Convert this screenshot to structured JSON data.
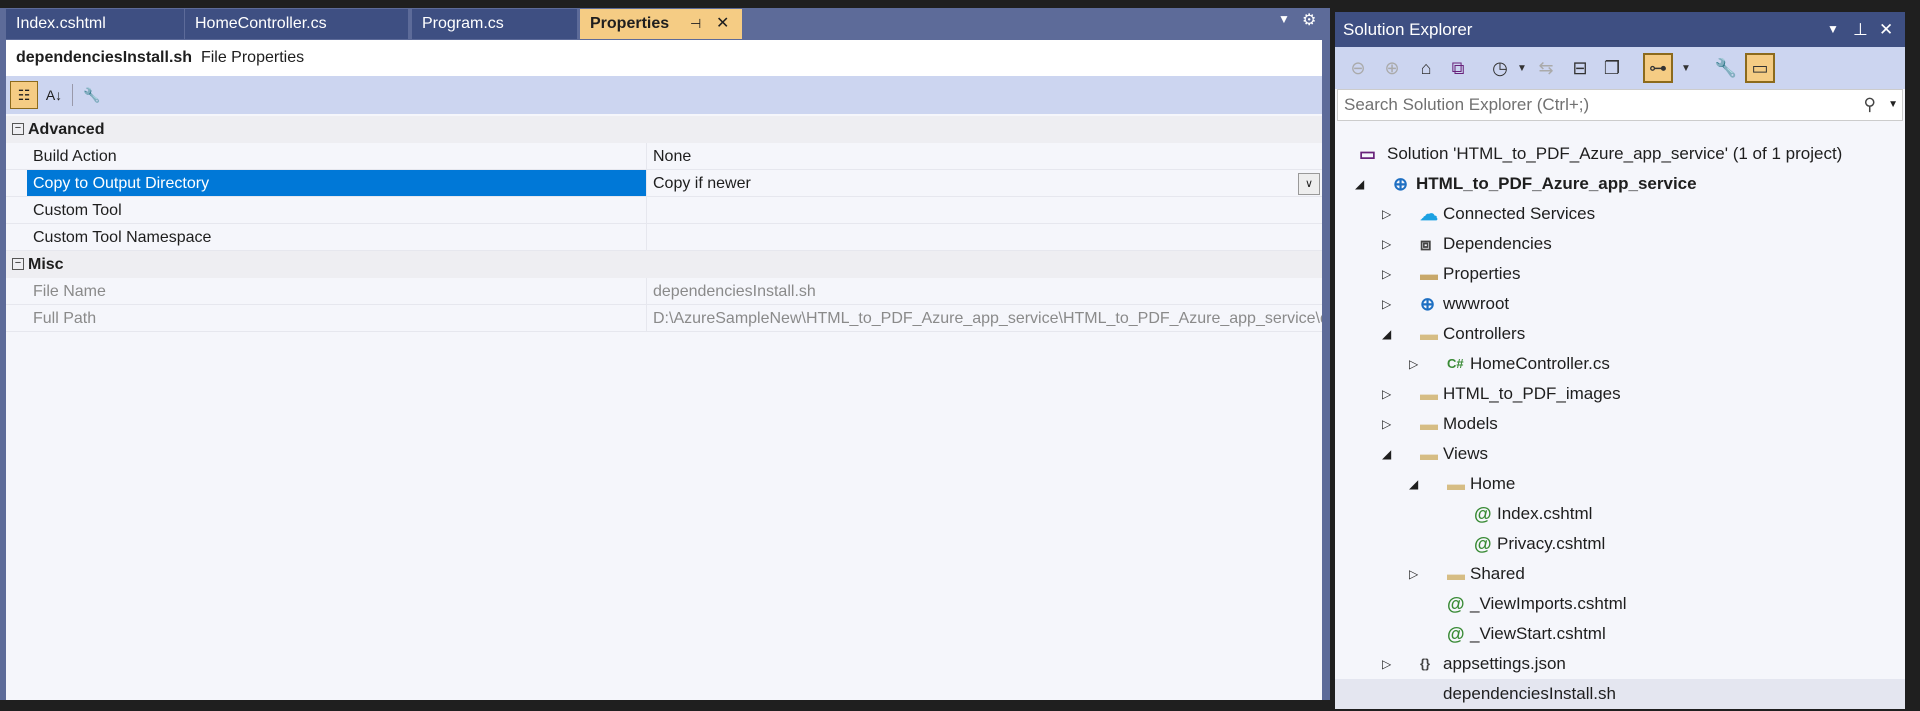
{
  "tabs": [
    {
      "label": "Index.cshtml"
    },
    {
      "label": "HomeController.cs"
    },
    {
      "label": "Program.cs"
    },
    {
      "label": "Properties",
      "active": true
    }
  ],
  "properties": {
    "file_name": "dependenciesInstall.sh",
    "subtitle": "File Properties",
    "categories": [
      {
        "name": "Advanced",
        "items": [
          {
            "label": "Build Action",
            "value": "None"
          },
          {
            "label": "Copy to Output Directory",
            "value": "Copy if newer",
            "selected": true
          },
          {
            "label": "Custom Tool",
            "value": ""
          },
          {
            "label": "Custom Tool Namespace",
            "value": ""
          }
        ]
      },
      {
        "name": "Misc",
        "items": [
          {
            "label": "File Name",
            "value": "dependenciesInstall.sh",
            "readonly": true
          },
          {
            "label": "Full Path",
            "value": "D:\\AzureSampleNew\\HTML_to_PDF_Azure_app_service\\HTML_to_PDF_Azure_app_service\\dependenciesInstall.sh",
            "readonly": true
          }
        ]
      }
    ]
  },
  "solution_explorer": {
    "title": "Solution Explorer",
    "search_placeholder": "Search Solution Explorer (Ctrl+;)",
    "tree": [
      {
        "label": "Solution 'HTML_to_PDF_Azure_app_service' (1 of 1 project)",
        "level": 0,
        "icon": "solution-icon"
      },
      {
        "label": "HTML_to_PDF_Azure_app_service",
        "level": 1,
        "icon": "web-project-icon",
        "state": "expanded",
        "bold": true
      },
      {
        "label": "Connected Services",
        "level": 2,
        "icon": "cloud-icon",
        "state": "collapsed"
      },
      {
        "label": "Dependencies",
        "level": 2,
        "icon": "dependencies-icon",
        "state": "collapsed"
      },
      {
        "label": "Properties",
        "level": 2,
        "icon": "properties-folder-icon",
        "state": "collapsed"
      },
      {
        "label": "wwwroot",
        "level": 2,
        "icon": "globe-icon",
        "state": "collapsed"
      },
      {
        "label": "Controllers",
        "level": 2,
        "icon": "folder-icon",
        "state": "expanded"
      },
      {
        "label": "HomeController.cs",
        "level": 3,
        "icon": "csharp-icon",
        "state": "collapsed"
      },
      {
        "label": "HTML_to_PDF_images",
        "level": 2,
        "icon": "folder-icon",
        "state": "collapsed"
      },
      {
        "label": "Models",
        "level": 2,
        "icon": "folder-icon",
        "state": "collapsed"
      },
      {
        "label": "Views",
        "level": 2,
        "icon": "folder-icon",
        "state": "expanded"
      },
      {
        "label": "Home",
        "level": 3,
        "icon": "folder-icon",
        "state": "expanded"
      },
      {
        "label": "Index.cshtml",
        "level": 4,
        "icon": "razor-icon"
      },
      {
        "label": "Privacy.cshtml",
        "level": 4,
        "icon": "razor-icon"
      },
      {
        "label": "Shared",
        "level": 3,
        "icon": "folder-icon",
        "state": "collapsed"
      },
      {
        "label": "_ViewImports.cshtml",
        "level": 3,
        "icon": "razor-icon"
      },
      {
        "label": "_ViewStart.cshtml",
        "level": 3,
        "icon": "razor-icon"
      },
      {
        "label": "appsettings.json",
        "level": 2,
        "icon": "json-icon",
        "state": "collapsed"
      },
      {
        "label": "dependenciesInstall.sh",
        "level": 2,
        "icon": "",
        "highlighted": true
      }
    ]
  },
  "colors": {
    "selection": "#0078d7",
    "active_tab": "#f5cc84",
    "title_bar": "#3e4f82",
    "toolbar": "#ccd5f0"
  }
}
